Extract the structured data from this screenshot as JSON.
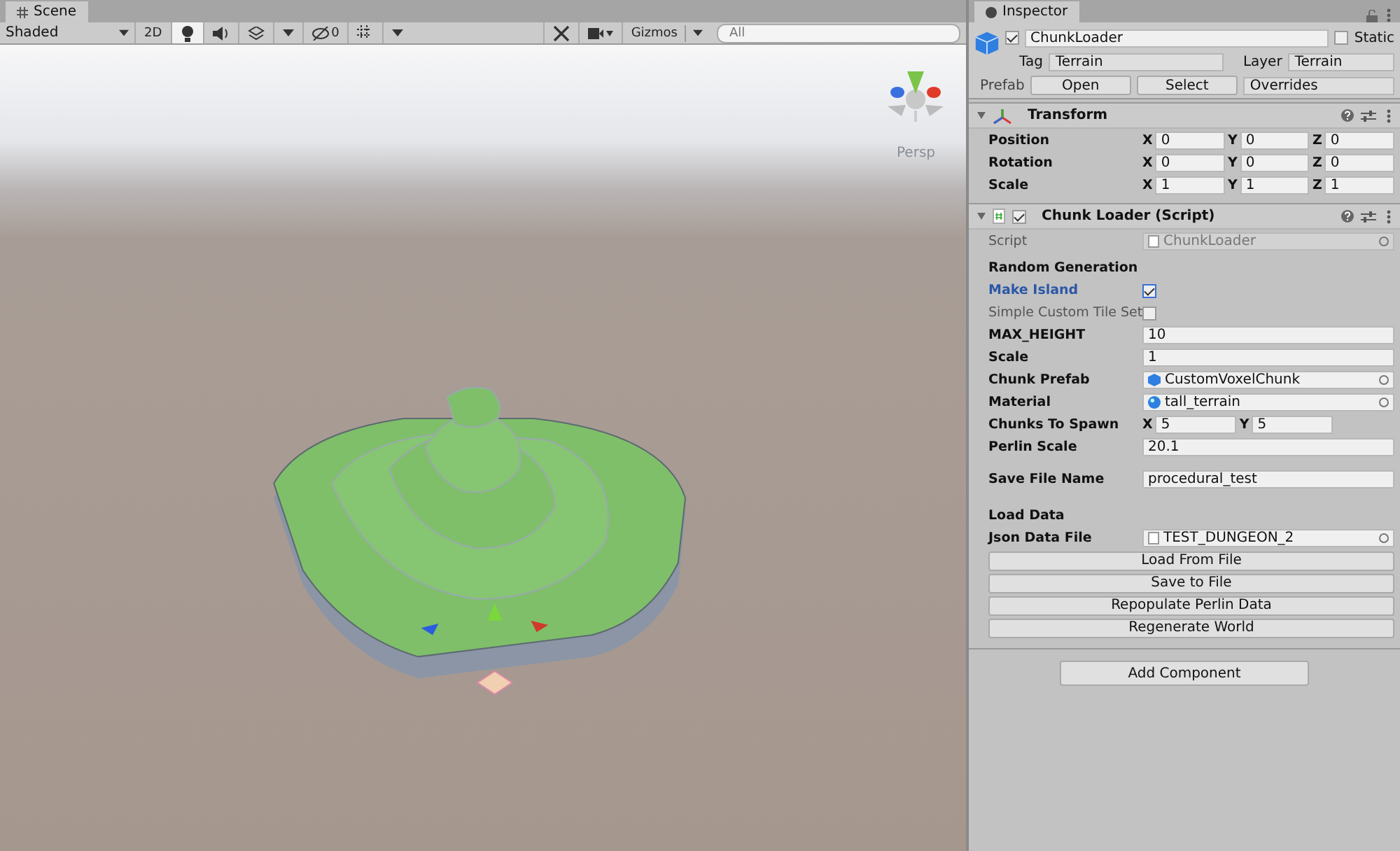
{
  "scene": {
    "tab": "Scene",
    "toolbar": {
      "shading": "Shaded",
      "mode_2d": "2D",
      "lighting_on": true,
      "audio_on": false,
      "effects_on": false,
      "grid_on": false,
      "hidden_count": "0",
      "gizmos": "Gizmos",
      "search": {
        "placeholder": "All"
      }
    },
    "view_label": "Persp"
  },
  "inspector": {
    "tab": "Inspector",
    "object": {
      "active": true,
      "name": "ChunkLoader",
      "static_label": "Static",
      "static": false,
      "tag_label": "Tag",
      "tag": "Terrain",
      "layer_label": "Layer",
      "layer": "Terrain",
      "prefab_label": "Prefab",
      "prefab_buttons": [
        "Open",
        "Select"
      ],
      "overrides": "Overrides"
    },
    "components": [
      {
        "kind": "transform",
        "title": "Transform",
        "expanded": true,
        "rows": [
          {
            "label": "Position",
            "values": [
              {
                "axis": "X",
                "value": "0"
              },
              {
                "axis": "Y",
                "value": "0"
              },
              {
                "axis": "Z",
                "value": "0"
              }
            ]
          },
          {
            "label": "Rotation",
            "values": [
              {
                "axis": "X",
                "value": "0"
              },
              {
                "axis": "Y",
                "value": "0"
              },
              {
                "axis": "Z",
                "value": "0"
              }
            ]
          },
          {
            "label": "Scale",
            "values": [
              {
                "axis": "X",
                "value": "1"
              },
              {
                "axis": "Y",
                "value": "1"
              },
              {
                "axis": "Z",
                "value": "1"
              }
            ]
          }
        ]
      },
      {
        "kind": "script",
        "title": "Chunk Loader (Script)",
        "expanded": true,
        "enabled": true,
        "fields": [
          {
            "kind": "script_object",
            "label": "Script",
            "value": "ChunkLoader",
            "disabled": true
          },
          {
            "kind": "header",
            "label": "Random Generation"
          },
          {
            "kind": "checkbox",
            "label": "Make Island",
            "checked": true,
            "focused": true,
            "dim": false
          },
          {
            "kind": "checkbox",
            "label": "Simple Custom Tile Set",
            "checked": false,
            "focused": false,
            "dim": true
          },
          {
            "kind": "text",
            "label": "MAX_HEIGHT",
            "value": "10"
          },
          {
            "kind": "text",
            "label": "Scale",
            "value": "1"
          },
          {
            "kind": "prefab_object",
            "label": "Chunk Prefab",
            "value": "CustomVoxelChunk",
            "disabled": false
          },
          {
            "kind": "material_object",
            "label": "Material",
            "value": "tall_terrain",
            "disabled": false
          },
          {
            "kind": "vector2",
            "label": "Chunks To Spawn",
            "values": [
              {
                "axis": "X",
                "value": "5"
              },
              {
                "axis": "Y",
                "value": "5"
              }
            ]
          },
          {
            "kind": "text",
            "label": "Perlin Scale",
            "value": "20.1"
          },
          {
            "kind": "spacer"
          },
          {
            "kind": "text",
            "label": "Save File Name",
            "value": "procedural_test"
          },
          {
            "kind": "spacer"
          },
          {
            "kind": "header",
            "label": "Load Data"
          },
          {
            "kind": "file_object",
            "label": "Json Data File",
            "value": "TEST_DUNGEON_2",
            "disabled": false
          },
          {
            "kind": "button",
            "label": "Load From File"
          },
          {
            "kind": "button",
            "label": "Save to File"
          },
          {
            "kind": "button",
            "label": "Repopulate Perlin Data"
          },
          {
            "kind": "button",
            "label": "Regenerate World"
          }
        ]
      }
    ],
    "add_component": "Add Component"
  }
}
